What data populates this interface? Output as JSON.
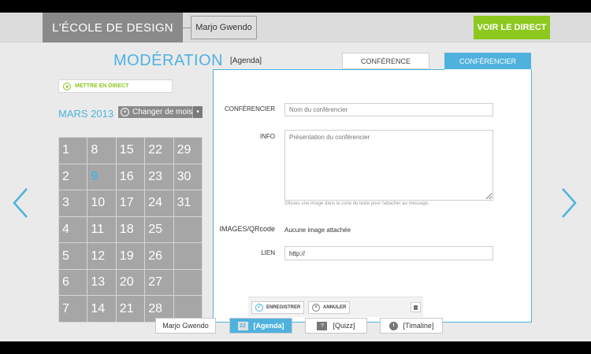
{
  "header": {
    "brand": "L'ÉCOLE DE DESIGN",
    "user": "Marjo Gwendo",
    "live_button": "VOIR LE DIRECT"
  },
  "page": {
    "title": "MODÉRATION",
    "section": "[Agenda]"
  },
  "tabs": [
    {
      "label": "CONFÉRENCE",
      "active": false
    },
    {
      "label": "CONFÉRENCIER",
      "active": true
    }
  ],
  "go_live_label": "METTRE EN DIRECT",
  "calendar": {
    "month": "MARS 2013",
    "change_button": "Changer de mois",
    "today": "9",
    "days": [
      "1",
      "8",
      "15",
      "22",
      "29",
      "2",
      "9",
      "16",
      "23",
      "30",
      "3",
      "10",
      "17",
      "24",
      "31",
      "4",
      "11",
      "18",
      "25",
      "",
      "5",
      "12",
      "19",
      "26",
      "",
      "6",
      "13",
      "20",
      "27",
      "",
      "7",
      "14",
      "21",
      "28",
      ""
    ]
  },
  "form": {
    "speaker_label": "CONFÉRENCIER",
    "speaker_placeholder": "Nom du conférencier",
    "info_label": "INFO",
    "info_placeholder": "Présentation du conférencier",
    "hint": "Glissez une image dans la zone de texte pour l'attacher au message.",
    "images_label": "IMAGES/QRcode",
    "images_value": "Aucune image attachée",
    "link_label": "LIEN",
    "link_value": "http://",
    "save_label": "ENREGISTRER",
    "cancel_label": "ANNULER"
  },
  "bottom_nav": [
    {
      "label": "Marjo Gwendo",
      "icon": ""
    },
    {
      "label": "[Agenda]",
      "icon": "calendar-icon"
    },
    {
      "label": "[Quizz]",
      "icon": "question-icon"
    },
    {
      "label": "[Timaline]",
      "icon": "clock-icon"
    }
  ],
  "colors": {
    "accent": "#4fb2de",
    "live": "#8dc81e",
    "calendar": "#a6a6a6"
  }
}
